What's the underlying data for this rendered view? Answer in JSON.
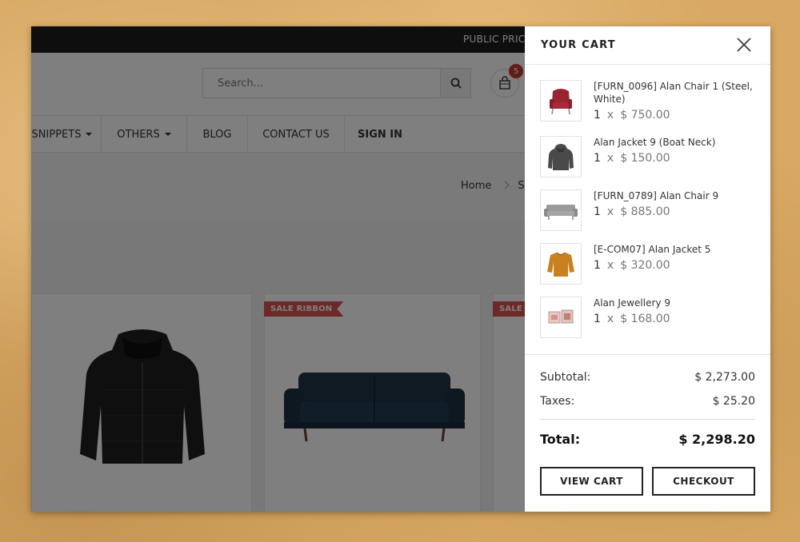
{
  "topbar": {
    "promo": "PUBLIC PRICELIST"
  },
  "header": {
    "search_placeholder": "Search...",
    "cart_count": "5"
  },
  "nav": {
    "items": [
      "SNIPPETS",
      "OTHERS",
      "BLOG",
      "CONTACT US",
      "SIGN IN"
    ]
  },
  "breadcrumb": {
    "home": "Home",
    "current": "S"
  },
  "products": {
    "ribbon_1": "SALE RIBBON",
    "ribbon_2": "SALE RIBBON"
  },
  "cart": {
    "title": "YOUR CART",
    "lines": [
      {
        "name": "[FURN_0096] Alan Chair 1 (Steel, White)",
        "qty": "1",
        "x": "x",
        "price": "$ 750.00",
        "icon": "red-armchair"
      },
      {
        "name": "Alan Jacket 9 (Boat Neck)",
        "qty": "1",
        "x": "x",
        "price": "$ 150.00",
        "icon": "grey-hoodie"
      },
      {
        "name": "[FURN_0789] Alan Chair 9",
        "qty": "1",
        "x": "x",
        "price": "$ 885.00",
        "icon": "grey-sofa"
      },
      {
        "name": "[E-COM07] Alan Jacket 5",
        "qty": "1",
        "x": "x",
        "price": "$ 320.00",
        "icon": "orange-sweater"
      },
      {
        "name": "Alan Jewellery 9",
        "qty": "1",
        "x": "x",
        "price": "$ 168.00",
        "icon": "jewellery-boxes"
      }
    ],
    "subtotal_label": "Subtotal:",
    "subtotal": "$ 2,273.00",
    "taxes_label": "Taxes:",
    "taxes": "$ 25.20",
    "total_label": "Total:",
    "total": "$ 2,298.20",
    "view_cart": "VIEW CART",
    "checkout": "CHECKOUT"
  }
}
